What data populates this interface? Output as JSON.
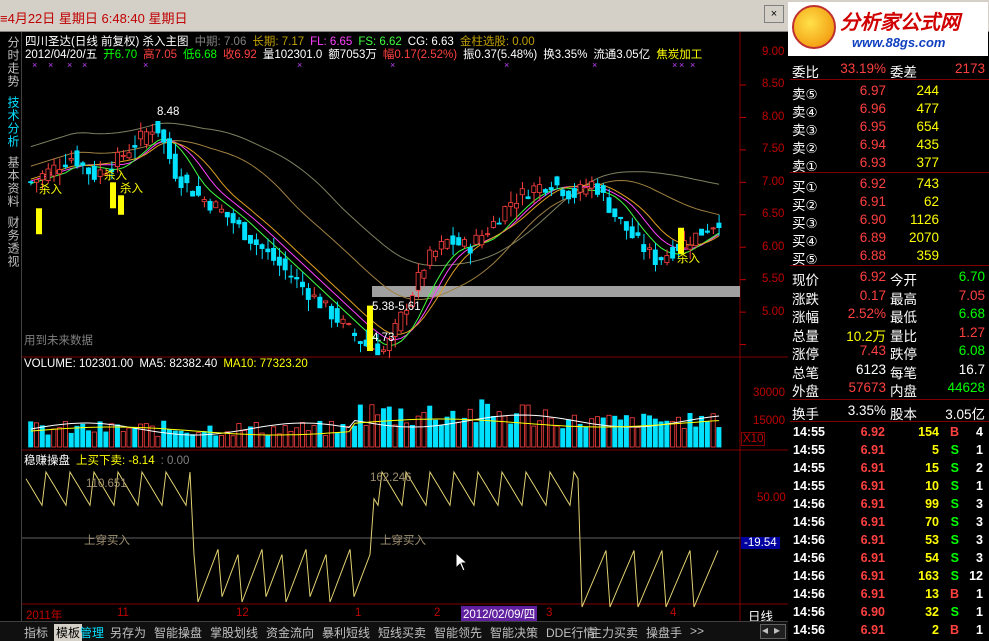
{
  "window": {
    "title": "≡4月22日  星期日  6:48:40 星期日",
    "close_label": "×"
  },
  "logo": {
    "name": "分析家公式网",
    "url": "www.88gs.com"
  },
  "left_tabs": [
    "分时走势",
    "技术分析",
    "基本资料",
    "财务透视"
  ],
  "chart_header": {
    "line1": [
      {
        "text": "四川圣达(日线 前复权) 杀入主图",
        "color": "#ffffff"
      },
      {
        "text": "中期: 7.06",
        "color": "#808080"
      },
      {
        "text": "长期: 7.17",
        "color": "#c0a000"
      },
      {
        "text": "FL: 6.65",
        "color": "#ff40ff"
      },
      {
        "text": "FS: 6.62",
        "color": "#40ff40"
      },
      {
        "text": "CG: 6.63",
        "color": "#ffffff"
      },
      {
        "text": "金柱选股: 0.00",
        "color": "#c0a000"
      }
    ],
    "line2": [
      {
        "text": "2012/04/20/五",
        "color": "#ffffff"
      },
      {
        "text": "开6.70",
        "color": "#00ff00"
      },
      {
        "text": "高7.05",
        "color": "#ff4040"
      },
      {
        "text": "低6.68",
        "color": "#00ff00"
      },
      {
        "text": "收6.92",
        "color": "#ff4040"
      },
      {
        "text": "量102301.0",
        "color": "#ffffff"
      },
      {
        "text": "额7053万",
        "color": "#ffffff"
      },
      {
        "text": "幅0.17(2.52%)",
        "color": "#ff4040"
      },
      {
        "text": "振0.37(5.48%)",
        "color": "#ffffff"
      },
      {
        "text": "换3.35%",
        "color": "#ffffff"
      },
      {
        "text": "流通3.05亿",
        "color": "#ffffff"
      },
      {
        "text": "焦炭加工",
        "color": "#ffff00"
      }
    ]
  },
  "price_axis": {
    "labels": [
      "9.00",
      "8.50",
      "8.00",
      "7.50",
      "7.00",
      "6.50",
      "6.00",
      "5.50",
      "5.00"
    ]
  },
  "annotations": {
    "high_label": "8.48",
    "low_label": "4.73",
    "zone_label": "5.38-5.61",
    "future_note": "用到未来数据",
    "buy_signal": "杀入"
  },
  "volume_panel": {
    "header": [
      {
        "text": "VOLUME: 102301.00",
        "color": "#ffffff"
      },
      {
        "text": "MA5: 82382.40",
        "color": "#ffffff"
      },
      {
        "text": "MA10: 77323.20",
        "color": "#ffff00"
      }
    ],
    "axis_labels": [
      "30000",
      "15000"
    ],
    "multiplier": "X10"
  },
  "indicator_panel": {
    "header": [
      {
        "text": "稳赚操盘",
        "color": "#ffffff"
      },
      {
        "text": "上买下卖: -8.14",
        "color": "#ffff00"
      },
      {
        "text": ": 0.00",
        "color": "#808080"
      }
    ],
    "peak_labels": [
      "110.651",
      "162.246"
    ],
    "cross_label": "上穿买入",
    "axis_label": "50.00",
    "current_value": "-19.54"
  },
  "date_axis": {
    "labels": [
      "2011年",
      "11",
      "12",
      "1",
      "2",
      "3",
      "4"
    ],
    "cursor_date": "2012/02/09/四",
    "period": "日线"
  },
  "chart_data": {
    "type": "candlestick",
    "ylim": [
      4.5,
      9.2
    ],
    "x": [
      "2011/10",
      "2011/11",
      "2011/12",
      "2012/01",
      "2012/02",
      "2012/03",
      "2012/04"
    ],
    "closes_approx": [
      7.5,
      7.7,
      7.9,
      7.6,
      7.8,
      8.1,
      8.4,
      7.6,
      7.3,
      7.1,
      6.8,
      6.5,
      6.2,
      5.9,
      5.6,
      5.3,
      5.0,
      4.9,
      5.6,
      6.3,
      6.6,
      6.5,
      6.8,
      7.2,
      7.4,
      7.5,
      7.3,
      7.5,
      7.0,
      6.6,
      6.3,
      6.5,
      6.7,
      6.92
    ],
    "series_labels": [
      "中期",
      "长期",
      "FL",
      "FS",
      "CG"
    ]
  },
  "quote": {
    "header": {
      "ratio_label": "委比",
      "ratio_value": "33.19%",
      "diff_label": "委差",
      "diff_value": "2173"
    },
    "sells": [
      {
        "label": "卖⑤",
        "price": "6.97",
        "vol": "244"
      },
      {
        "label": "卖④",
        "price": "6.96",
        "vol": "477"
      },
      {
        "label": "卖③",
        "price": "6.95",
        "vol": "654"
      },
      {
        "label": "卖②",
        "price": "6.94",
        "vol": "435"
      },
      {
        "label": "卖①",
        "price": "6.93",
        "vol": "377"
      }
    ],
    "buys": [
      {
        "label": "买①",
        "price": "6.92",
        "vol": "743"
      },
      {
        "label": "买②",
        "price": "6.91",
        "vol": "62"
      },
      {
        "label": "买③",
        "price": "6.90",
        "vol": "1126"
      },
      {
        "label": "买④",
        "price": "6.89",
        "vol": "2070"
      },
      {
        "label": "买⑤",
        "price": "6.88",
        "vol": "359"
      }
    ],
    "stats": [
      {
        "l1": "现价",
        "v1": "6.92",
        "c1": "#ff4040",
        "l2": "今开",
        "v2": "6.70",
        "c2": "#00ff00"
      },
      {
        "l1": "涨跌",
        "v1": "0.17",
        "c1": "#ff4040",
        "l2": "最高",
        "v2": "7.05",
        "c2": "#ff4040"
      },
      {
        "l1": "涨幅",
        "v1": "2.52%",
        "c1": "#ff4040",
        "l2": "最低",
        "v2": "6.68",
        "c2": "#00ff00"
      },
      {
        "l1": "总量",
        "v1": "10.2万",
        "c1": "#ffff00",
        "l2": "量比",
        "v2": "1.27",
        "c2": "#ff4040"
      },
      {
        "l1": "涨停",
        "v1": "7.43",
        "c1": "#ff4040",
        "l2": "跌停",
        "v2": "6.08",
        "c2": "#00ff00"
      },
      {
        "l1": "总笔",
        "v1": "6123",
        "c1": "#ffffff",
        "l2": "每笔",
        "v2": "16.7",
        "c2": "#ffffff"
      },
      {
        "l1": "外盘",
        "v1": "57673",
        "c1": "#ff4040",
        "l2": "内盘",
        "v2": "44628",
        "c2": "#00ff00"
      }
    ],
    "turnover": {
      "l1": "换手",
      "v1": "3.35%",
      "l2": "股本",
      "v2": "3.05亿"
    }
  },
  "trades": [
    {
      "time": "14:55",
      "price": "6.92",
      "vol": "154",
      "side": "B",
      "n": "4"
    },
    {
      "time": "14:55",
      "price": "6.91",
      "vol": "5",
      "side": "S",
      "n": "1"
    },
    {
      "time": "14:55",
      "price": "6.91",
      "vol": "15",
      "side": "S",
      "n": "2"
    },
    {
      "time": "14:55",
      "price": "6.91",
      "vol": "10",
      "side": "S",
      "n": "1"
    },
    {
      "time": "14:56",
      "price": "6.91",
      "vol": "99",
      "side": "S",
      "n": "3"
    },
    {
      "time": "14:56",
      "price": "6.91",
      "vol": "70",
      "side": "S",
      "n": "3"
    },
    {
      "time": "14:56",
      "price": "6.91",
      "vol": "53",
      "side": "S",
      "n": "3"
    },
    {
      "time": "14:56",
      "price": "6.91",
      "vol": "54",
      "side": "S",
      "n": "3"
    },
    {
      "time": "14:56",
      "price": "6.91",
      "vol": "163",
      "side": "S",
      "n": "12"
    },
    {
      "time": "14:56",
      "price": "6.91",
      "vol": "13",
      "side": "B",
      "n": "1"
    },
    {
      "time": "14:56",
      "price": "6.90",
      "vol": "32",
      "side": "S",
      "n": "1"
    },
    {
      "time": "14:56",
      "price": "6.91",
      "vol": "2",
      "side": "B",
      "n": "1"
    }
  ],
  "bottom_tabs": [
    {
      "label": "指标",
      "state": "normal"
    },
    {
      "label": "模板",
      "state": "selected"
    },
    {
      "label": "管理",
      "state": "active"
    },
    {
      "label": "另存为",
      "state": "normal"
    },
    {
      "label": "智能操盘",
      "state": "normal"
    },
    {
      "label": "掌股划线",
      "state": "normal"
    },
    {
      "label": "资金流向",
      "state": "normal"
    },
    {
      "label": "暴利短线",
      "state": "normal"
    },
    {
      "label": "短线买卖",
      "state": "normal"
    },
    {
      "label": "智能领先",
      "state": "normal"
    },
    {
      "label": "智能决策",
      "state": "normal"
    },
    {
      "label": "DDE行情",
      "state": "normal"
    },
    {
      "label": "主力买卖",
      "state": "normal"
    },
    {
      "label": "操盘手",
      "state": "normal"
    },
    {
      "label": ">>",
      "state": "normal"
    }
  ],
  "colors": {
    "up": "#ff4040",
    "down": "#00e0ff",
    "signal": "#ffff00",
    "grid": "#800000"
  }
}
